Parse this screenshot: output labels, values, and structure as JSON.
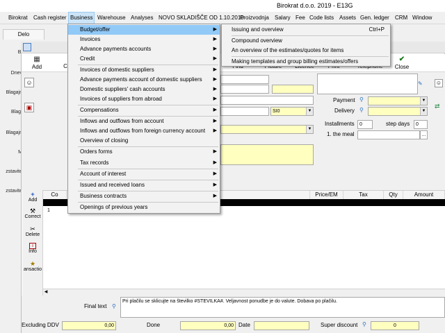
{
  "window": {
    "title": "Birokrat d.o.o. 2019 - E13G"
  },
  "menubar": [
    "Birokrat",
    "Cash register",
    "Business",
    "Warehouse",
    "Analyses",
    "NOVO SKLADIŠČE OD 1.10.2010",
    "Proizvodnja",
    "Salary",
    "Fee",
    "Code lists",
    "Assets",
    "Gen. ledger",
    "CRM",
    "Window"
  ],
  "tab": {
    "label": "Delo"
  },
  "left_labels": [
    "Bi",
    "Dnev",
    "Blagajn",
    "Blag.",
    "Blagajn",
    "M",
    "zstavite",
    "zstavite"
  ],
  "toolbar": {
    "add": "Add",
    "c": "C",
    "find": "Find",
    "picture": "Picture",
    "licence": "Licence",
    "print": "Print",
    "telephone": "Telephone",
    "close": "Close"
  },
  "form": {
    "currency": "SI0",
    "payment_label": "Payment",
    "delivery_label": "Delivery",
    "installments_label": "Installments",
    "installments_value": "0",
    "step_days_label": "step days",
    "step_days_value": "0",
    "meal_label": "1. the meal",
    "meal_btn": "..."
  },
  "side_tools": [
    "Add",
    "Correct",
    "Delete",
    "Info",
    "ansactio"
  ],
  "grid": {
    "columns": [
      "Co",
      "Comment",
      "Price/EM",
      "Tax",
      "Qty",
      "Amount"
    ],
    "row_number": "1"
  },
  "bottom": {
    "final_text_label": "Final text",
    "final_text": "Pri plačilu se sklicujte na številko #STEVILKA#. Veljavnost ponudbe je do valute. Dobava po plačilu.",
    "excluding_ddv_label": "Excluding DDV",
    "excluding_ddv_value": "0,00",
    "done_label": "Done",
    "done_value": "0,00",
    "date_label": "Date",
    "super_discount_label": "Super discount",
    "super_discount_value": "0"
  },
  "business_menu": {
    "items": [
      "Budget/offer",
      "Invoices",
      "Advance payments accounts",
      "Credit",
      "Invoices of domestic suppliers",
      "Advance payments account of domestic suppliers",
      "Domestic suppliers' cash accounts",
      "Invoices of suppliers from abroad",
      "Compensations",
      "Inflows and outflows from account",
      "Inflows and outflows from foreign currency account",
      "Overview of closing",
      "Orders forms",
      "Tax records",
      "Account of interest",
      "Issued and received loans",
      "Business contracts",
      "Openings of previous years"
    ]
  },
  "budget_submenu": {
    "items": [
      "Issuing and overview",
      "Compound overview",
      "An overview of the estimates/quotes for items",
      "Making templates and group billing estimates/offers"
    ],
    "shortcut": "Ctrl+P"
  },
  "colors": {
    "highlight": "#91c9f7",
    "field_yellow": "#ffffc0",
    "menu_bg": "#f2f2f2"
  }
}
